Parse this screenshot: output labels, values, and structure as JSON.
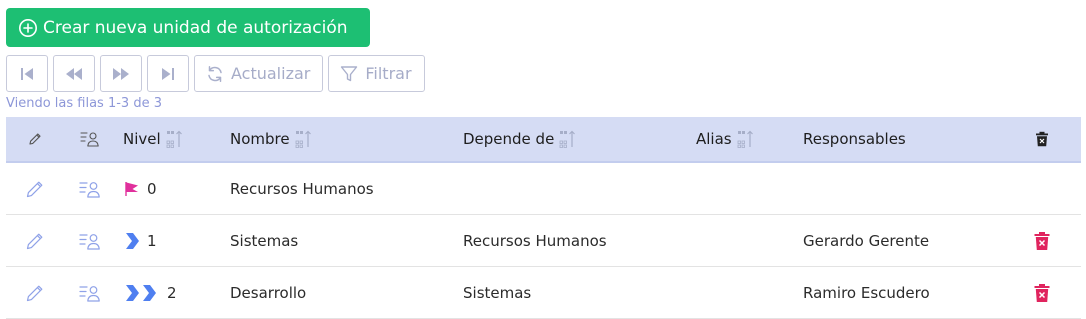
{
  "actions": {
    "create_label": "Crear nueva unidad de autorización"
  },
  "toolbar": {
    "refresh_label": "Actualizar",
    "filter_label": "Filtrar"
  },
  "pagination": {
    "rows_info": "Viendo las filas 1-3 de 3"
  },
  "colors": {
    "primary": "#1dbf73",
    "header_bg": "#d5dcf4",
    "level_chevron": "#4f7ff0",
    "root_flag": "#e0309c",
    "delete": "#e0245e"
  },
  "table": {
    "columns": {
      "nivel": "Nivel",
      "nombre": "Nombre",
      "depende": "Depende de",
      "alias": "Alias",
      "responsables": "Responsables"
    },
    "rows": [
      {
        "nivel": "0",
        "level_icon": "flag-icon",
        "nombre": "Recursos Humanos",
        "depende": "",
        "alias": "",
        "responsables": "",
        "deletable": false
      },
      {
        "nivel": "1",
        "level_icon": "chevron-right-icon",
        "nombre": "Sistemas",
        "depende": "Recursos Humanos",
        "alias": "",
        "responsables": "Gerardo Gerente",
        "deletable": true
      },
      {
        "nivel": "2",
        "level_icon": "double-chevron-right-icon",
        "nombre": "Desarrollo",
        "depende": "Sistemas",
        "alias": "",
        "responsables": "Ramiro Escudero",
        "deletable": true
      }
    ]
  }
}
